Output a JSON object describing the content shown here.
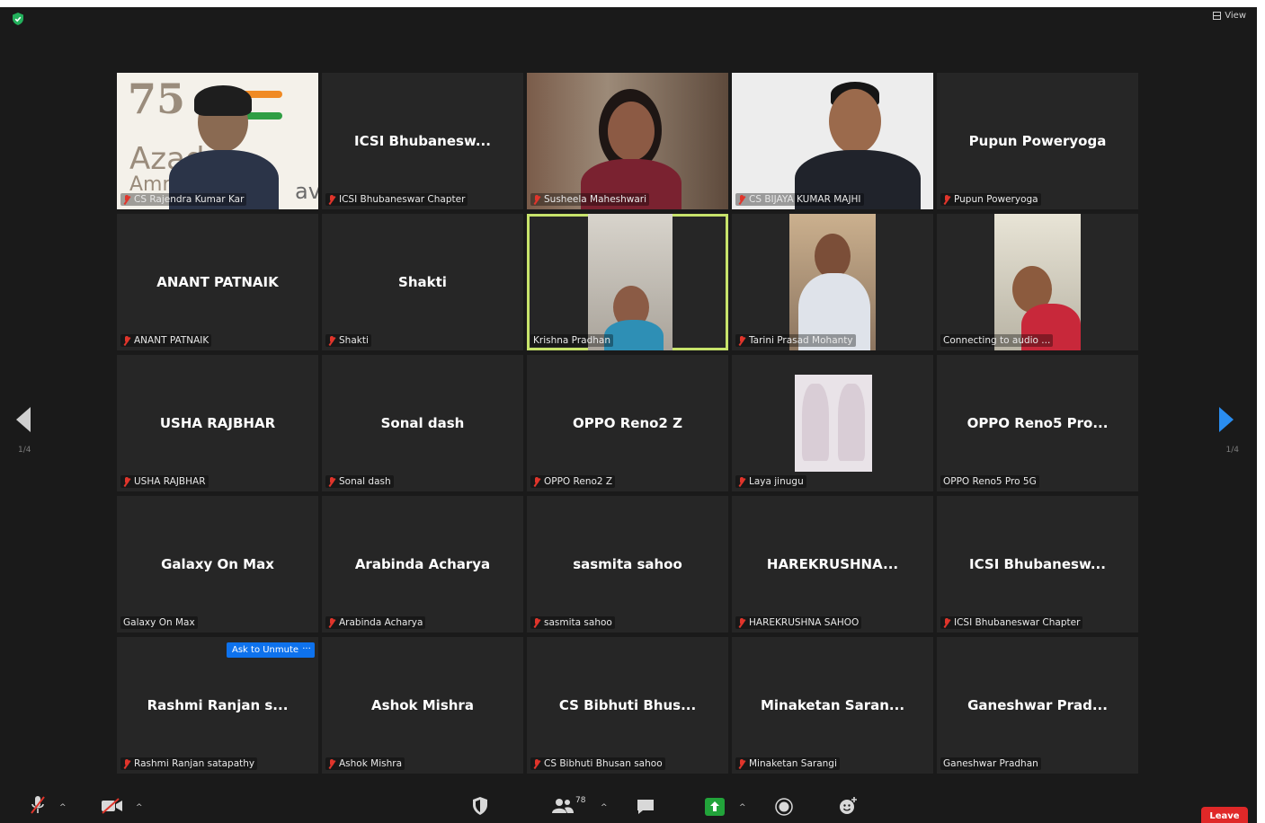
{
  "top": {
    "view_label": "View"
  },
  "nav": {
    "page_left": "1/4",
    "page_right": "1/4"
  },
  "tiles": [
    {
      "big": "",
      "label": "CS Rajendra Kumar Kar",
      "muted": true,
      "video": "banner"
    },
    {
      "big": "ICSI Bhubanesw...",
      "label": "ICSI Bhubaneswar Chapter",
      "muted": true,
      "video": ""
    },
    {
      "big": "",
      "label": "Susheela Maheshwari",
      "muted": true,
      "video": "person-f"
    },
    {
      "big": "",
      "label": "CS BIJAYA KUMAR MAJHI",
      "muted": true,
      "video": "person-m"
    },
    {
      "big": "Pupun Poweryoga",
      "label": "Pupun Poweryoga",
      "muted": true,
      "video": ""
    },
    {
      "big": "ANANT PATNAIK",
      "label": "ANANT PATNAIK",
      "muted": true,
      "video": ""
    },
    {
      "big": "Shakti",
      "label": "Shakti",
      "muted": true,
      "video": ""
    },
    {
      "big": "",
      "label": "Krishna Pradhan",
      "muted": false,
      "video": "portrait-f",
      "active": true
    },
    {
      "big": "",
      "label": "Tarini Prasad Mohanty",
      "muted": true,
      "video": "portrait-m"
    },
    {
      "big": "",
      "label": "Connecting to audio ...",
      "muted": false,
      "video": "portrait-m2"
    },
    {
      "big": "USHA RAJBHAR",
      "label": "USHA RAJBHAR",
      "muted": true,
      "video": ""
    },
    {
      "big": "Sonal dash",
      "label": "Sonal dash",
      "muted": true,
      "video": ""
    },
    {
      "big": "OPPO Reno2 Z",
      "label": "OPPO Reno2 Z",
      "muted": true,
      "video": ""
    },
    {
      "big": "",
      "label": "Laya jinugu",
      "muted": true,
      "video": "photo"
    },
    {
      "big": "OPPO Reno5 Pro...",
      "label": "OPPO Reno5 Pro 5G",
      "muted": false,
      "video": ""
    },
    {
      "big": "Galaxy On Max",
      "label": "Galaxy On Max",
      "muted": false,
      "video": ""
    },
    {
      "big": "Arabinda Acharya",
      "label": "Arabinda Acharya",
      "muted": true,
      "video": ""
    },
    {
      "big": "sasmita sahoo",
      "label": "sasmita sahoo",
      "muted": true,
      "video": ""
    },
    {
      "big": "HAREKRUSHNA...",
      "label": "HAREKRUSHNA SAHOO",
      "muted": true,
      "video": ""
    },
    {
      "big": "ICSI Bhubanesw...",
      "label": "ICSI Bhubaneswar Chapter",
      "muted": true,
      "video": ""
    },
    {
      "big": "Rashmi Ranjan s...",
      "label": "Rashmi Ranjan satapathy",
      "muted": true,
      "video": "",
      "ask_unmute": "Ask to Unmute",
      "more": "···"
    },
    {
      "big": "Ashok Mishra",
      "label": "Ashok Mishra",
      "muted": true,
      "video": ""
    },
    {
      "big": "CS Bibhuti Bhus...",
      "label": "CS Bibhuti Bhusan sahoo",
      "muted": true,
      "video": ""
    },
    {
      "big": "Minaketan Saran...",
      "label": "Minaketan Sarangi",
      "muted": true,
      "video": ""
    },
    {
      "big": "Ganeshwar Prad...",
      "label": "Ganeshwar Pradhan",
      "muted": false,
      "video": ""
    }
  ],
  "banner": {
    "number": "75",
    "text1": "Azad",
    "text2": "Amrit",
    "tail": "av"
  },
  "toolbar": {
    "participants_count": "78",
    "leave_label": "Leave"
  },
  "icons": [
    "shield-icon",
    "view-icon",
    "mic-muted-icon",
    "video-off-icon",
    "security-icon",
    "participants-icon",
    "chat-icon",
    "share-screen-icon",
    "record-icon",
    "reactions-icon",
    "prev-page-icon",
    "next-page-icon"
  ],
  "colors": {
    "active_border": "#c7e36b",
    "leave": "#e02828",
    "accent": "#0e72ed",
    "share": "#22a33a"
  }
}
